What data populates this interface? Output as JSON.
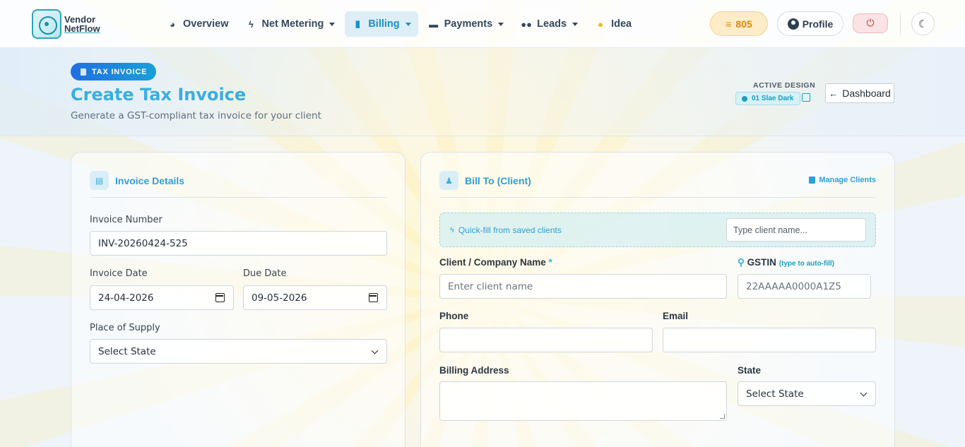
{
  "nav": {
    "logo_line1": "Vendor",
    "logo_line2": "NetFlow",
    "items": [
      {
        "label": "Overview",
        "icon": "chart-pie-icon",
        "dropdown": false,
        "active": false
      },
      {
        "label": "Net Metering",
        "icon": "bolt-icon",
        "dropdown": true,
        "active": false
      },
      {
        "label": "Billing",
        "icon": "invoice-icon",
        "dropdown": true,
        "active": true
      },
      {
        "label": "Payments",
        "icon": "wallet-icon",
        "dropdown": true,
        "active": false
      },
      {
        "label": "Leads",
        "icon": "users-icon",
        "dropdown": true,
        "active": false
      },
      {
        "label": "Idea",
        "icon": "lightbulb-icon",
        "dropdown": false,
        "active": false
      }
    ],
    "coins": "805",
    "profile_label": "Profile"
  },
  "header": {
    "tag": "TAX INVOICE",
    "title": "Create Tax Invoice",
    "subtitle": "Generate a GST-compliant tax invoice for your client",
    "active_design_label": "ACTIVE DESIGN",
    "active_design_value": "01 Slae Dark",
    "dashboard_label": "Dashboard"
  },
  "invoice_details": {
    "title": "Invoice Details",
    "invoice_number_label": "Invoice Number",
    "invoice_number": "INV-20260424-525",
    "invoice_date_label": "Invoice Date",
    "invoice_date": "24-04-2026",
    "due_date_label": "Due Date",
    "due_date": "09-05-2026",
    "place_of_supply_label": "Place of Supply",
    "place_of_supply": "Select State"
  },
  "bill_to": {
    "title": "Bill To (Client)",
    "manage_clients": "Manage Clients",
    "quickfill_label": "Quick-fill from saved clients",
    "quickfill_placeholder": "Type client name...",
    "client_name_label": "Client / Company Name",
    "client_name_required": "*",
    "client_name_placeholder": "Enter client name",
    "gstin_label": "GSTIN",
    "gstin_hint": "(type to auto-fill)",
    "gstin_placeholder": "22AAAAA0000A1Z5",
    "phone_label": "Phone",
    "phone": "",
    "email_label": "Email",
    "email": "",
    "billing_address_label": "Billing Address",
    "billing_address": "",
    "state_label": "State",
    "state": "Select State"
  },
  "colors": {
    "accent": "#3aaee0",
    "active_nav_bg": "#ddeef7",
    "coins": "#d88b0b"
  }
}
